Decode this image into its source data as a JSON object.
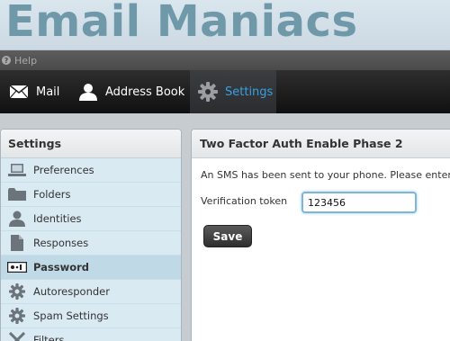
{
  "app": {
    "brand": "Email Maniacs"
  },
  "topbar": {
    "help_label": "Help",
    "help_icon": "question-circle-icon"
  },
  "tabs": [
    {
      "label": "Mail",
      "icon": "envelope-icon"
    },
    {
      "label": "Address Book",
      "icon": "person-icon"
    },
    {
      "label": "Settings",
      "icon": "gear-icon",
      "active": true
    }
  ],
  "sidebar": {
    "title": "Settings",
    "items": [
      {
        "label": "Preferences",
        "icon": "laptop-icon"
      },
      {
        "label": "Folders",
        "icon": "folder-icon"
      },
      {
        "label": "Identities",
        "icon": "person-icon"
      },
      {
        "label": "Responses",
        "icon": "document-icon"
      },
      {
        "label": "Password",
        "icon": "password-icon",
        "active": true
      },
      {
        "label": "Autoresponder",
        "icon": "gear-icon"
      },
      {
        "label": "Spam Settings",
        "icon": "gear-icon"
      },
      {
        "label": "Filters",
        "icon": "filter-icon"
      }
    ]
  },
  "main": {
    "title": "Two Factor Auth Enable Phase 2",
    "message": "An SMS has been sent to your phone. Please enter the",
    "token_label": "Verification token",
    "token_value": "123456",
    "save_label": "Save"
  },
  "colors": {
    "accent": "#3aa0df",
    "brand": "#6f98a9",
    "sidebar_bg": "#d9eaf2",
    "sidebar_active": "#bfd9e6"
  }
}
